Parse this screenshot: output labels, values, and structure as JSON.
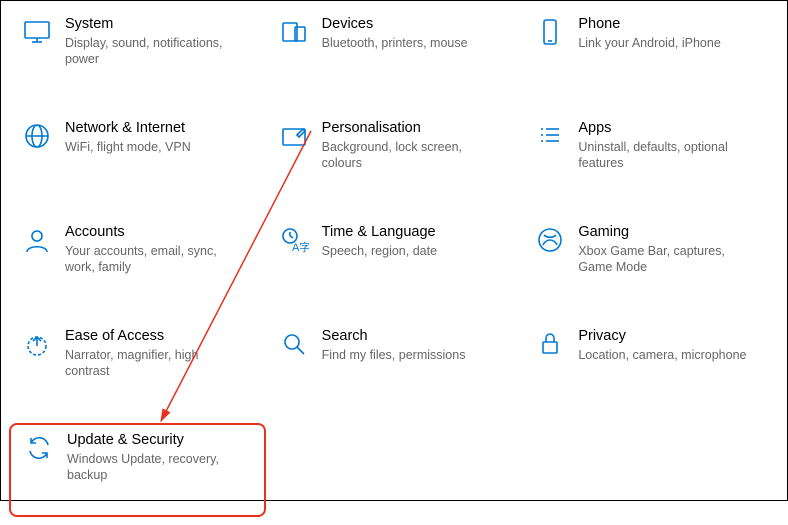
{
  "accent_color": "#0078d4",
  "annotation_color": "#e8311e",
  "settings": [
    {
      "id": "system",
      "title": "System",
      "desc": "Display, sound, notifications, power"
    },
    {
      "id": "devices",
      "title": "Devices",
      "desc": "Bluetooth, printers, mouse"
    },
    {
      "id": "phone",
      "title": "Phone",
      "desc": "Link your Android, iPhone"
    },
    {
      "id": "network",
      "title": "Network & Internet",
      "desc": "WiFi, flight mode, VPN"
    },
    {
      "id": "personalisation",
      "title": "Personalisation",
      "desc": "Background, lock screen, colours"
    },
    {
      "id": "apps",
      "title": "Apps",
      "desc": "Uninstall, defaults, optional features"
    },
    {
      "id": "accounts",
      "title": "Accounts",
      "desc": "Your accounts, email, sync, work, family"
    },
    {
      "id": "time-language",
      "title": "Time & Language",
      "desc": "Speech, region, date"
    },
    {
      "id": "gaming",
      "title": "Gaming",
      "desc": "Xbox Game Bar, captures, Game Mode"
    },
    {
      "id": "ease-of-access",
      "title": "Ease of Access",
      "desc": "Narrator, magnifier, high contrast"
    },
    {
      "id": "search",
      "title": "Search",
      "desc": "Find my files, permissions"
    },
    {
      "id": "privacy",
      "title": "Privacy",
      "desc": "Location, camera, microphone"
    },
    {
      "id": "update-security",
      "title": "Update & Security",
      "desc": "Windows Update, recovery, backup"
    }
  ],
  "annotation": {
    "arrow_from_tile": "personalisation",
    "arrow_to_tile": "update-security",
    "highlight_tile": "update-security"
  }
}
